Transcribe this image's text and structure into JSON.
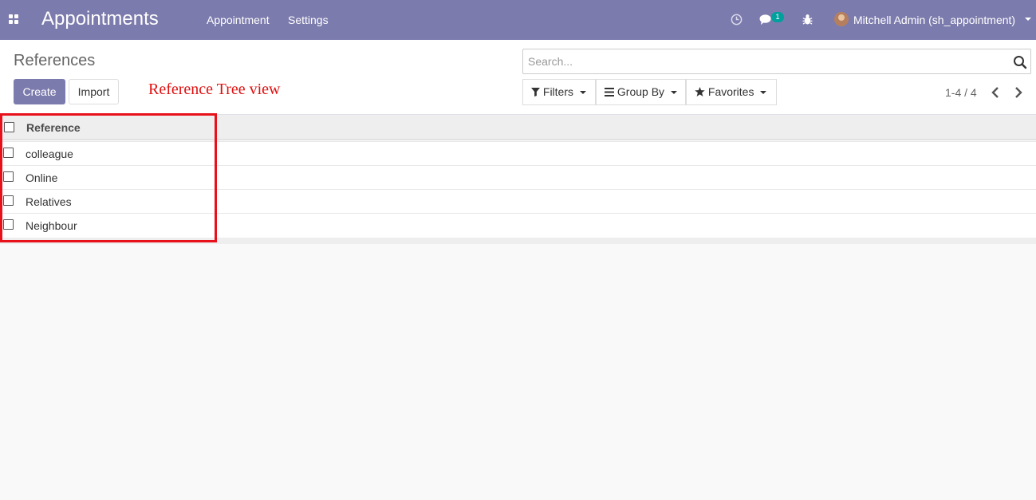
{
  "navbar": {
    "app_title": "Appointments",
    "menu": [
      "Appointment",
      "Settings"
    ],
    "chat_badge": "1",
    "user_name": "Mitchell Admin (sh_appointment)",
    "icons": [
      "apps-icon",
      "clock-icon",
      "chat-icon",
      "bug-icon",
      "avatar"
    ]
  },
  "control_panel": {
    "breadcrumb": "References",
    "create_label": "Create",
    "import_label": "Import",
    "annotation": "Reference Tree view",
    "search_placeholder": "Search...",
    "filters_label": "Filters",
    "group_by_label": "Group By",
    "favorites_label": "Favorites",
    "pager": "1-4 / 4"
  },
  "list": {
    "column_header": "Reference",
    "rows": [
      "colleague",
      "Online",
      "Relatives",
      "Neighbour"
    ]
  },
  "colors": {
    "brand": "#7c7bad",
    "badge": "#00a09d",
    "annotation": "#e01010"
  }
}
